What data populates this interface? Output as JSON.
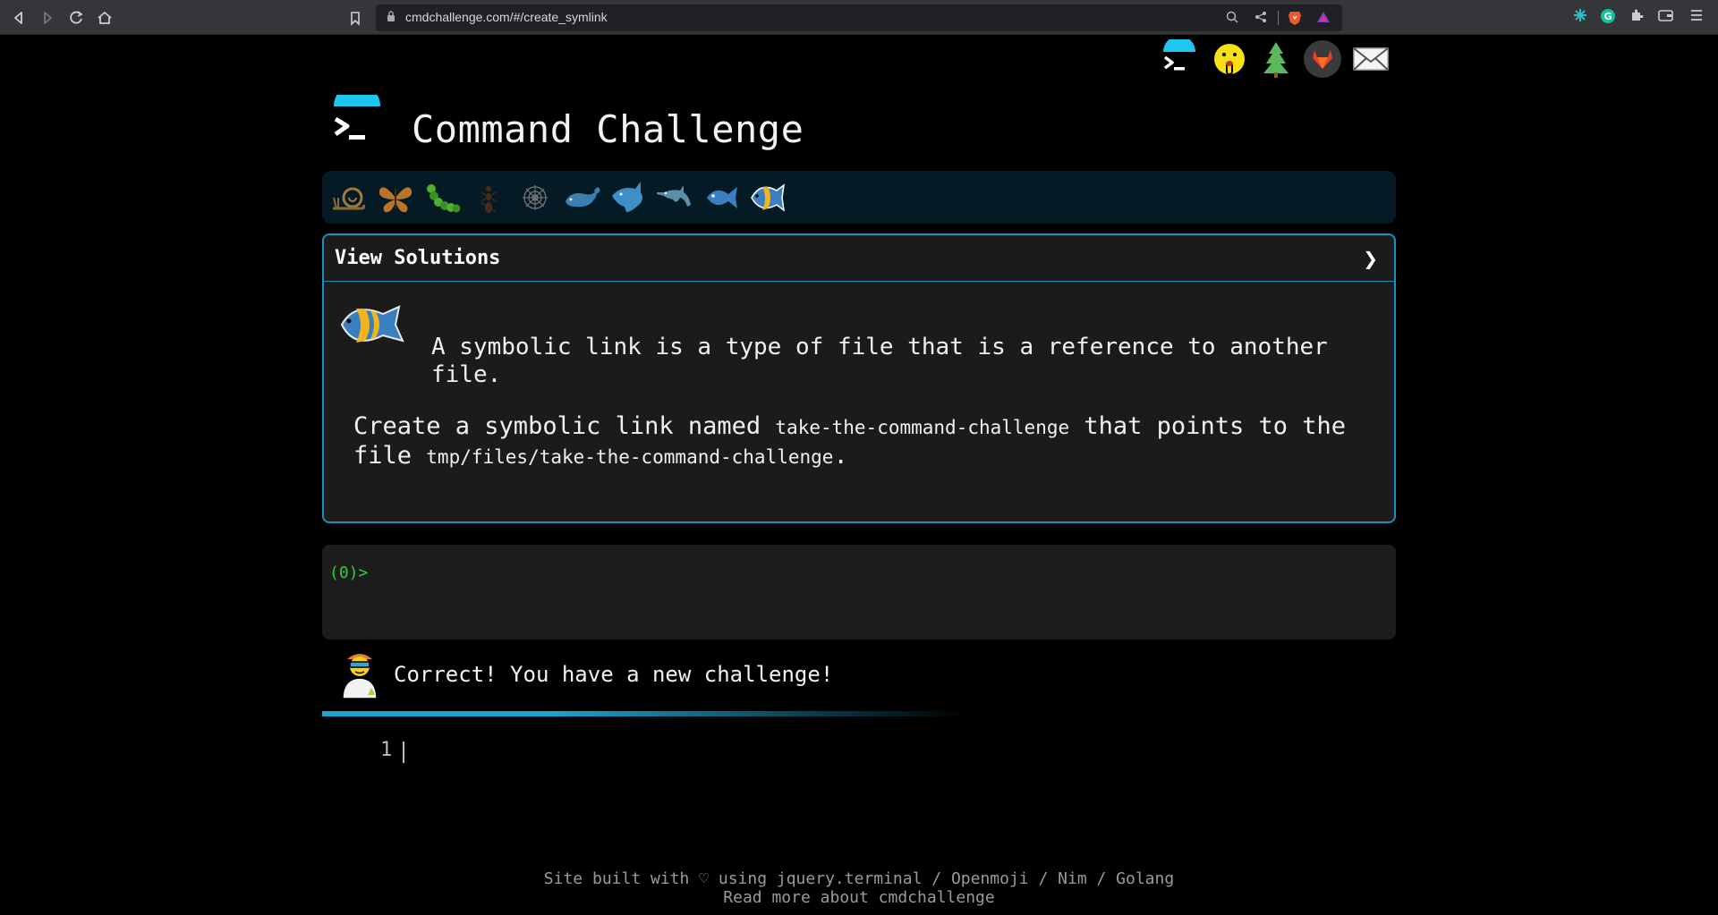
{
  "browser": {
    "url": "cmdchallenge.com/#/create_symlink",
    "nav": {
      "back": "back-icon",
      "forward": "forward-icon",
      "reload": "reload-icon",
      "home": "home-icon"
    },
    "url_icons": [
      "bookmark-icon",
      "lock-icon",
      "zoom-icon",
      "share-icon",
      "brave-shield-icon",
      "brave-rewards-icon"
    ],
    "extensions": [
      "perplexity-icon",
      "grammarly-icon",
      "extensions-icon",
      "wallet-icon",
      "menu-icon"
    ]
  },
  "top_icons": [
    "terminal-logo-icon",
    "shushing-face-icon",
    "tree-icon",
    "gitlab-icon",
    "email-icon"
  ],
  "header": {
    "title": "Command Challenge"
  },
  "animals": [
    "snail-icon",
    "butterfly-icon",
    "caterpillar-icon",
    "ant-icon",
    "spider-web-icon",
    "whale-icon",
    "shark-icon",
    "dolphin-icon",
    "fish-icon",
    "tropical-fish-icon"
  ],
  "solutions": {
    "label": "View Solutions",
    "chevron": "❯",
    "description": "A symbolic link is a type of file that is a reference to another file.",
    "task_prefix": "Create a symbolic link named ",
    "task_code1": "take-the-command-challenge",
    "task_mid": " that points to the file ",
    "task_code2": "tmp/files/take-the-command-challenge",
    "task_suffix": "."
  },
  "terminal": {
    "prompt": "(0)>"
  },
  "status": {
    "message": "Correct! You have a new challenge!"
  },
  "editor": {
    "line_number": "1"
  },
  "footer": {
    "line1": "Site built with ♡ using jquery.terminal / Openmoji / Nim / Golang",
    "line2": "Read more about cmdchallenge"
  },
  "colors": {
    "accent": "#1e8fb5",
    "prompt": "#2ecc40",
    "bar_bg": "#041a24"
  }
}
